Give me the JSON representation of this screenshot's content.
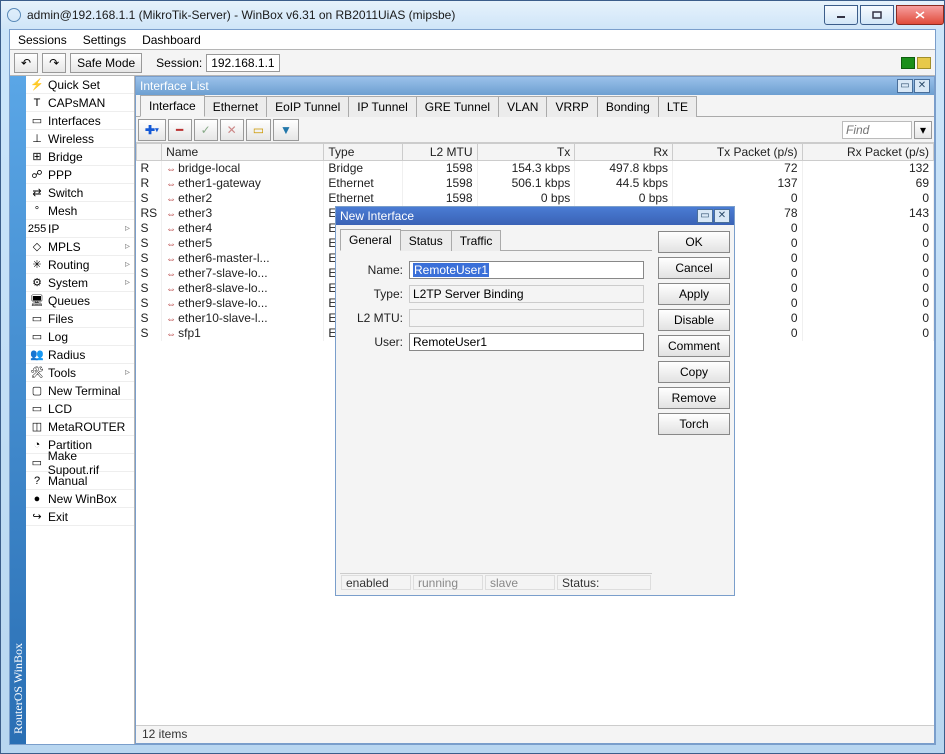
{
  "window": {
    "title": "admin@192.168.1.1 (MikroTik-Server) - WinBox v6.31 on RB2011UiAS (mipsbe)"
  },
  "menubar": [
    "Sessions",
    "Settings",
    "Dashboard"
  ],
  "toolbar": {
    "safe_mode": "Safe Mode",
    "session_label": "Session:",
    "session_value": "192.168.1.1"
  },
  "sidebar_title": "RouterOS WinBox",
  "sidebar": [
    {
      "label": "Quick Set",
      "icon": "⚡"
    },
    {
      "label": "CAPsMAN",
      "icon": "T"
    },
    {
      "label": "Interfaces",
      "icon": "▭"
    },
    {
      "label": "Wireless",
      "icon": "⊥"
    },
    {
      "label": "Bridge",
      "icon": "⊞"
    },
    {
      "label": "PPP",
      "icon": "☍"
    },
    {
      "label": "Switch",
      "icon": "⇄"
    },
    {
      "label": "Mesh",
      "icon": "°"
    },
    {
      "label": "IP",
      "icon": "255",
      "sub": true
    },
    {
      "label": "MPLS",
      "icon": "◇",
      "sub": true
    },
    {
      "label": "Routing",
      "icon": "✳",
      "sub": true
    },
    {
      "label": "System",
      "icon": "⚙",
      "sub": true
    },
    {
      "label": "Queues",
      "icon": "🖥"
    },
    {
      "label": "Files",
      "icon": "▭"
    },
    {
      "label": "Log",
      "icon": "▭"
    },
    {
      "label": "Radius",
      "icon": "👥"
    },
    {
      "label": "Tools",
      "icon": "🛠",
      "sub": true
    },
    {
      "label": "New Terminal",
      "icon": "▢"
    },
    {
      "label": "LCD",
      "icon": "▭"
    },
    {
      "label": "MetaROUTER",
      "icon": "◫"
    },
    {
      "label": "Partition",
      "icon": "◔"
    },
    {
      "label": "Make Supout.rif",
      "icon": "▭"
    },
    {
      "label": "Manual",
      "icon": "?"
    },
    {
      "label": "New WinBox",
      "icon": "●"
    },
    {
      "label": "Exit",
      "icon": "↪"
    }
  ],
  "iface_panel": {
    "title": "Interface List",
    "tabs": [
      "Interface",
      "Ethernet",
      "EoIP Tunnel",
      "IP Tunnel",
      "GRE Tunnel",
      "VLAN",
      "VRRP",
      "Bonding",
      "LTE"
    ],
    "find": "Find",
    "cols": [
      "",
      "Name",
      "Type",
      "L2 MTU",
      "Tx",
      "Rx",
      "Tx Packet (p/s)",
      "Rx Packet (p/s)"
    ],
    "rows": [
      {
        "f": "R",
        "n": "bridge-local",
        "t": "Bridge",
        "mtu": "1598",
        "tx": "154.3 kbps",
        "rx": "497.8 kbps",
        "txp": "72",
        "rxp": "132"
      },
      {
        "f": "R",
        "n": "ether1-gateway",
        "t": "Ethernet",
        "mtu": "1598",
        "tx": "506.1 kbps",
        "rx": "44.5 kbps",
        "txp": "137",
        "rxp": "69"
      },
      {
        "f": "S",
        "n": "ether2",
        "t": "Ethernet",
        "mtu": "1598",
        "tx": "0 bps",
        "rx": "0 bps",
        "txp": "0",
        "rxp": "0"
      },
      {
        "f": "RS",
        "n": "ether3",
        "t": "Ethernet",
        "mtu": "",
        "tx": "",
        "rx": "",
        "txp": "78",
        "rxp": "143"
      },
      {
        "f": "S",
        "n": "ether4",
        "t": "Ethernet",
        "mtu": "",
        "tx": "",
        "rx": "",
        "txp": "0",
        "rxp": "0"
      },
      {
        "f": "S",
        "n": "ether5",
        "t": "Ethernet",
        "mtu": "",
        "tx": "",
        "rx": "",
        "txp": "0",
        "rxp": "0"
      },
      {
        "f": "S",
        "n": "ether6-master-l...",
        "t": "Ethernet",
        "mtu": "",
        "tx": "",
        "rx": "",
        "txp": "0",
        "rxp": "0"
      },
      {
        "f": "S",
        "n": "ether7-slave-lo...",
        "t": "Ethernet",
        "mtu": "",
        "tx": "",
        "rx": "",
        "txp": "0",
        "rxp": "0"
      },
      {
        "f": "S",
        "n": "ether8-slave-lo...",
        "t": "Ethernet",
        "mtu": "",
        "tx": "",
        "rx": "",
        "txp": "0",
        "rxp": "0"
      },
      {
        "f": "S",
        "n": "ether9-slave-lo...",
        "t": "Ethernet",
        "mtu": "",
        "tx": "",
        "rx": "",
        "txp": "0",
        "rxp": "0"
      },
      {
        "f": "S",
        "n": "ether10-slave-l...",
        "t": "Ethernet",
        "mtu": "",
        "tx": "",
        "rx": "",
        "txp": "0",
        "rxp": "0"
      },
      {
        "f": "S",
        "n": "sfp1",
        "t": "Ethernet",
        "mtu": "",
        "tx": "",
        "rx": "",
        "txp": "0",
        "rxp": "0"
      }
    ],
    "status": "12 items"
  },
  "dialog": {
    "title": "New Interface",
    "tabs": [
      "General",
      "Status",
      "Traffic"
    ],
    "fields": {
      "name_label": "Name:",
      "name_value": "RemoteUser1",
      "type_label": "Type:",
      "type_value": "L2TP Server Binding",
      "mtu_label": "L2 MTU:",
      "mtu_value": "",
      "user_label": "User:",
      "user_value": "RemoteUser1"
    },
    "buttons": [
      "OK",
      "Cancel",
      "Apply",
      "Disable",
      "Comment",
      "Copy",
      "Remove",
      "Torch"
    ],
    "footer": {
      "enabled": "enabled",
      "running": "running",
      "slave": "slave",
      "status": "Status:"
    }
  }
}
